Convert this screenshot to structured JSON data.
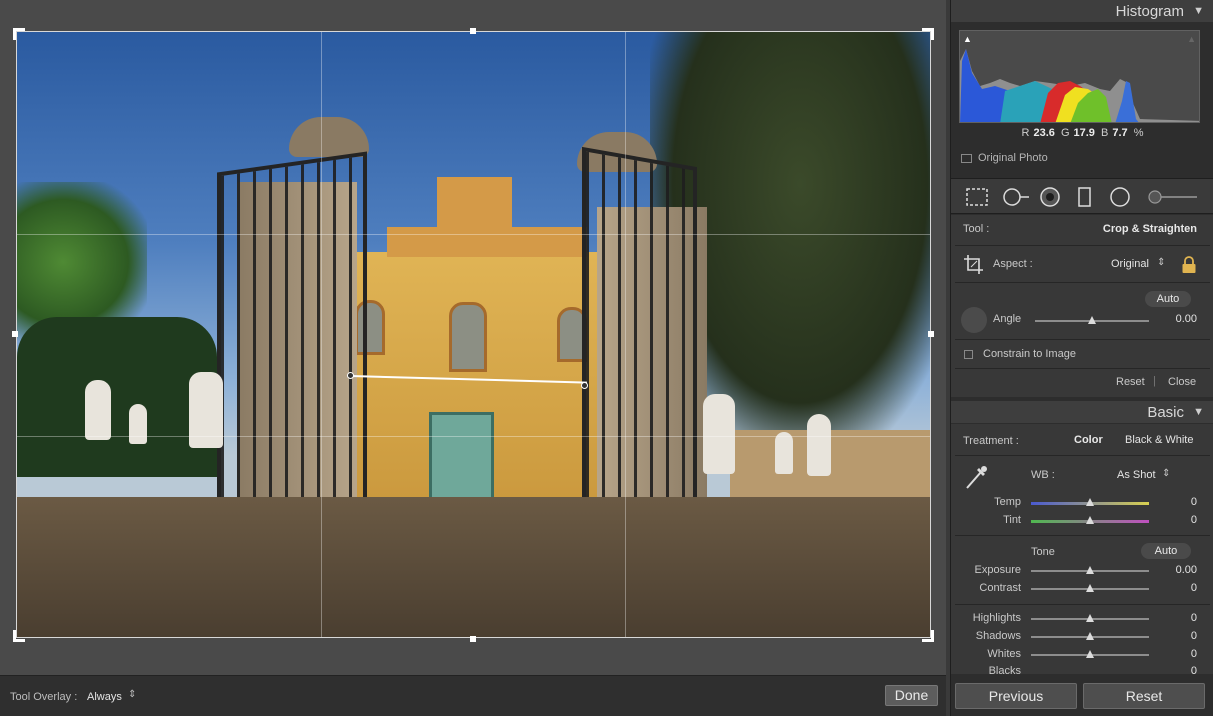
{
  "workspace": {
    "tool_overlay_label": "Tool Overlay :",
    "tool_overlay_value": "Always",
    "tool_overlay_chevron": "⇕",
    "done_label": "Done"
  },
  "histogram": {
    "title": "Histogram",
    "r_label": "R",
    "r_value": "23.6",
    "g_label": "G",
    "g_value": "17.9",
    "b_label": "B",
    "b_value": "7.7",
    "percent": "%",
    "original_photo_label": "Original Photo"
  },
  "toolstrip": {
    "icons": [
      "crop-overlay-icon",
      "spot-removal-icon",
      "red-eye-icon",
      "graduated-filter-icon",
      "radial-filter-icon",
      "adjustment-brush-icon"
    ]
  },
  "crop": {
    "tool_label": "Tool :",
    "tool_value": "Crop & Straighten",
    "aspect_label": "Aspect :",
    "aspect_value": "Original",
    "aspect_chevron": "⇕",
    "auto_label": "Auto",
    "angle_label": "Angle",
    "angle_value": "0.00",
    "constrain_label": "Constrain to Image",
    "reset_label": "Reset",
    "close_label": "Close",
    "angle_slider_position": 0.5
  },
  "basic": {
    "title": "Basic",
    "treatment_label": "Treatment :",
    "treatment_color": "Color",
    "treatment_bw": "Black & White",
    "wb_label": "WB :",
    "wb_value": "As Shot",
    "wb_chevron": "⇕",
    "temp_label": "Temp",
    "temp_value": "0",
    "tint_label": "Tint",
    "tint_value": "0",
    "tone_label": "Tone",
    "tone_auto": "Auto",
    "exposure_label": "Exposure",
    "exposure_value": "0.00",
    "contrast_label": "Contrast",
    "contrast_value": "0",
    "highlights_label": "Highlights",
    "highlights_value": "0",
    "shadows_label": "Shadows",
    "shadows_value": "0",
    "whites_label": "Whites",
    "whites_value": "0",
    "blacks_label": "Blacks",
    "blacks_value": "0"
  },
  "footer": {
    "previous_label": "Previous",
    "reset_label": "Reset"
  },
  "colors": {
    "panel_bg": "#2d2d2d",
    "section_bg": "#383838",
    "accent_text": "#e8e8e8"
  }
}
